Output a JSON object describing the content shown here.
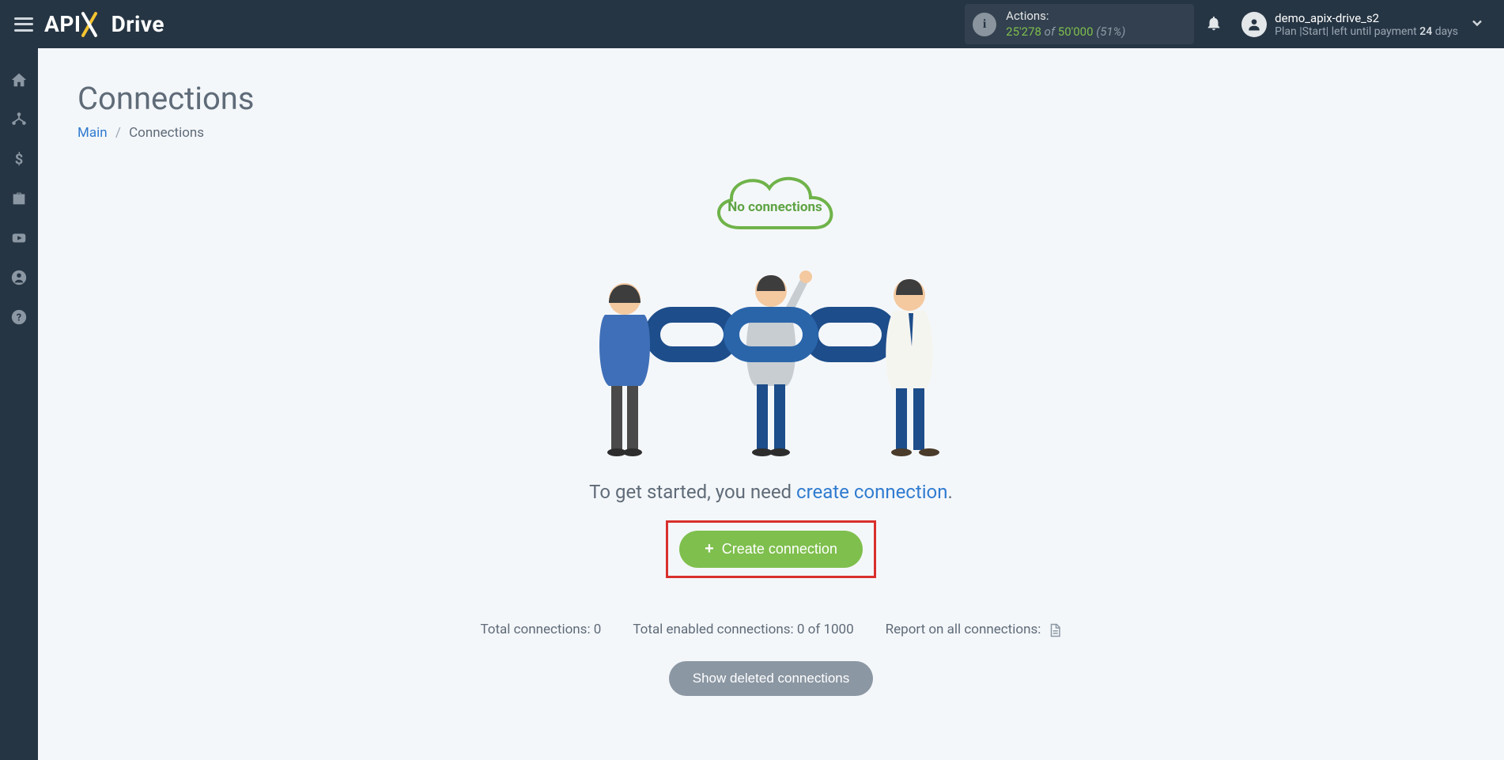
{
  "header": {
    "actions": {
      "label": "Actions:",
      "used": "25'278",
      "of": "of",
      "total": "50'000",
      "pct": "(51%)"
    },
    "account": {
      "name": "demo_apix-drive_s2",
      "plan_prefix": "Plan |Start| left until payment",
      "plan_bold": "24",
      "plan_suffix": "days"
    }
  },
  "page": {
    "title": "Connections",
    "breadcrumb_home": "Main",
    "breadcrumb_current": "Connections"
  },
  "empty": {
    "cloud_text": "No connections",
    "start_prefix": "To get started, you need ",
    "start_link": "create connection",
    "start_suffix": ".",
    "create_btn": "Create connection"
  },
  "stats": {
    "total_label": "Total connections:",
    "total_value": "0",
    "enabled_label": "Total enabled connections:",
    "enabled_value": "0 of 1000",
    "report_label": "Report on all connections:"
  },
  "deleted_btn": "Show deleted connections"
}
